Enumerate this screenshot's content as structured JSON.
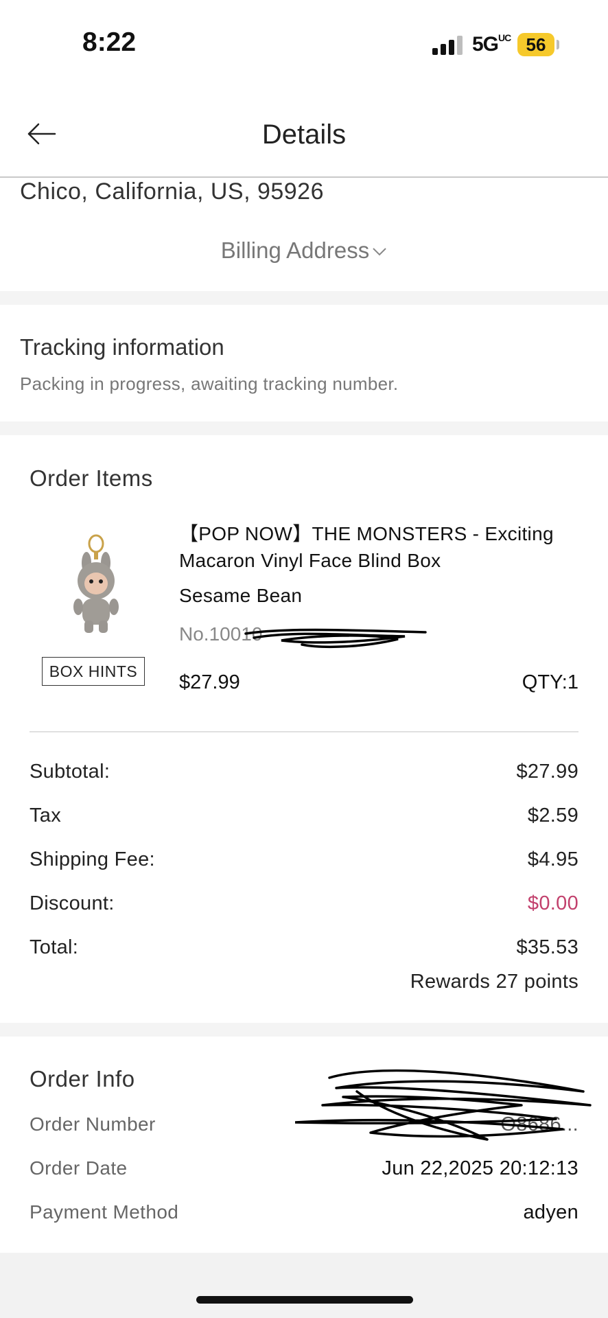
{
  "status_bar": {
    "time": "8:22",
    "network": "5G",
    "network_suffix": "UC",
    "battery": "56",
    "battery_color": "#f6c92b"
  },
  "header": {
    "title": "Details",
    "back_icon": "arrow-left-icon"
  },
  "address": {
    "line": "Chico, California, US, 95926",
    "billing_toggle": "Billing Address",
    "toggle_icon": "chevron-down-icon"
  },
  "tracking": {
    "title": "Tracking information",
    "status": "Packing in progress, awaiting tracking number."
  },
  "order_items": {
    "title": "Order Items",
    "items": [
      {
        "name": "【POP NOW】THE MONSTERS - Exciting Macaron Vinyl Face Blind Box",
        "variant": "Sesame Bean",
        "sku": "No.10010",
        "price": "$27.99",
        "qty": "QTY:1",
        "hint_button": "BOX HINTS"
      }
    ],
    "summary": {
      "subtotal_label": "Subtotal:",
      "subtotal": "$27.99",
      "tax_label": "Tax",
      "tax": "$2.59",
      "shipping_label": "Shipping Fee:",
      "shipping": "$4.95",
      "discount_label": "Discount:",
      "discount": "$0.00",
      "discount_color": "#c2416d",
      "total_label": "Total:",
      "total": "$35.53",
      "rewards": "Rewards 27 points"
    }
  },
  "order_info": {
    "title": "Order Info",
    "order_number_label": "Order Number",
    "order_number": "O8686...",
    "order_date_label": "Order Date",
    "order_date": "Jun 22,2025 20:12:13",
    "payment_method_label": "Payment Method",
    "payment_method": "adyen"
  }
}
